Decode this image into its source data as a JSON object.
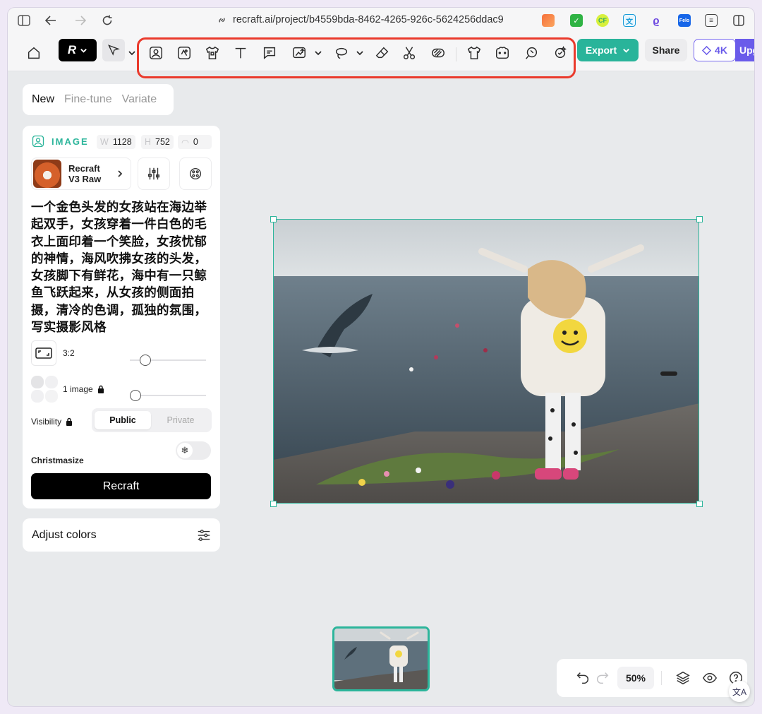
{
  "browser": {
    "url": "recraft.ai/project/b4559bda-8462-4265-926c-5624256ddac9",
    "extensions": [
      "extension-orange-icon",
      "checkmark-extension-icon",
      "cf-extension-icon",
      "translate-extension-icon",
      "purple-extension-icon",
      "felo-extension-icon",
      "sliders-extension-icon"
    ],
    "ext_felo_label": "Felo"
  },
  "toolbar": {
    "logo_label": "R",
    "export_label": "Export",
    "share_label": "Share",
    "resolution_label": "4K",
    "upgrade_label": "Upg",
    "accent_color": "#29b49a",
    "highlight_color": "#ea3a2c"
  },
  "left_panel": {
    "tabs": [
      {
        "label": "New",
        "active": true
      },
      {
        "label": "Fine-tune",
        "active": false
      },
      {
        "label": "Variate",
        "active": false
      }
    ],
    "type_label": "IMAGE",
    "width_key": "W",
    "width_value": "1128",
    "height_key": "H",
    "height_value": "752",
    "seed_value": "0",
    "model_line1": "Recraft",
    "model_line2": "V3 Raw",
    "prompt": "一个金色头发的女孩站在海边举起双手，女孩穿着一件白色的毛衣上面印着一个笑脸，女孩忧郁的神情，海风吹拂女孩的头发，女孩脚下有鲜花，海中有一只鲸鱼飞跃起来，从女孩的侧面拍摄，清冷的色调，孤独的氛围，写实摄影风格",
    "aspect_ratio": "3:2",
    "image_count": "1 image",
    "visibility_label": "Visibility",
    "visibility_options": [
      "Public",
      "Private"
    ],
    "visibility_selected": "Public",
    "christmasize_label": "Christmasize",
    "generate_label": "Recraft",
    "adjust_colors_label": "Adjust colors"
  },
  "canvas": {
    "zoom_label": "50%"
  }
}
